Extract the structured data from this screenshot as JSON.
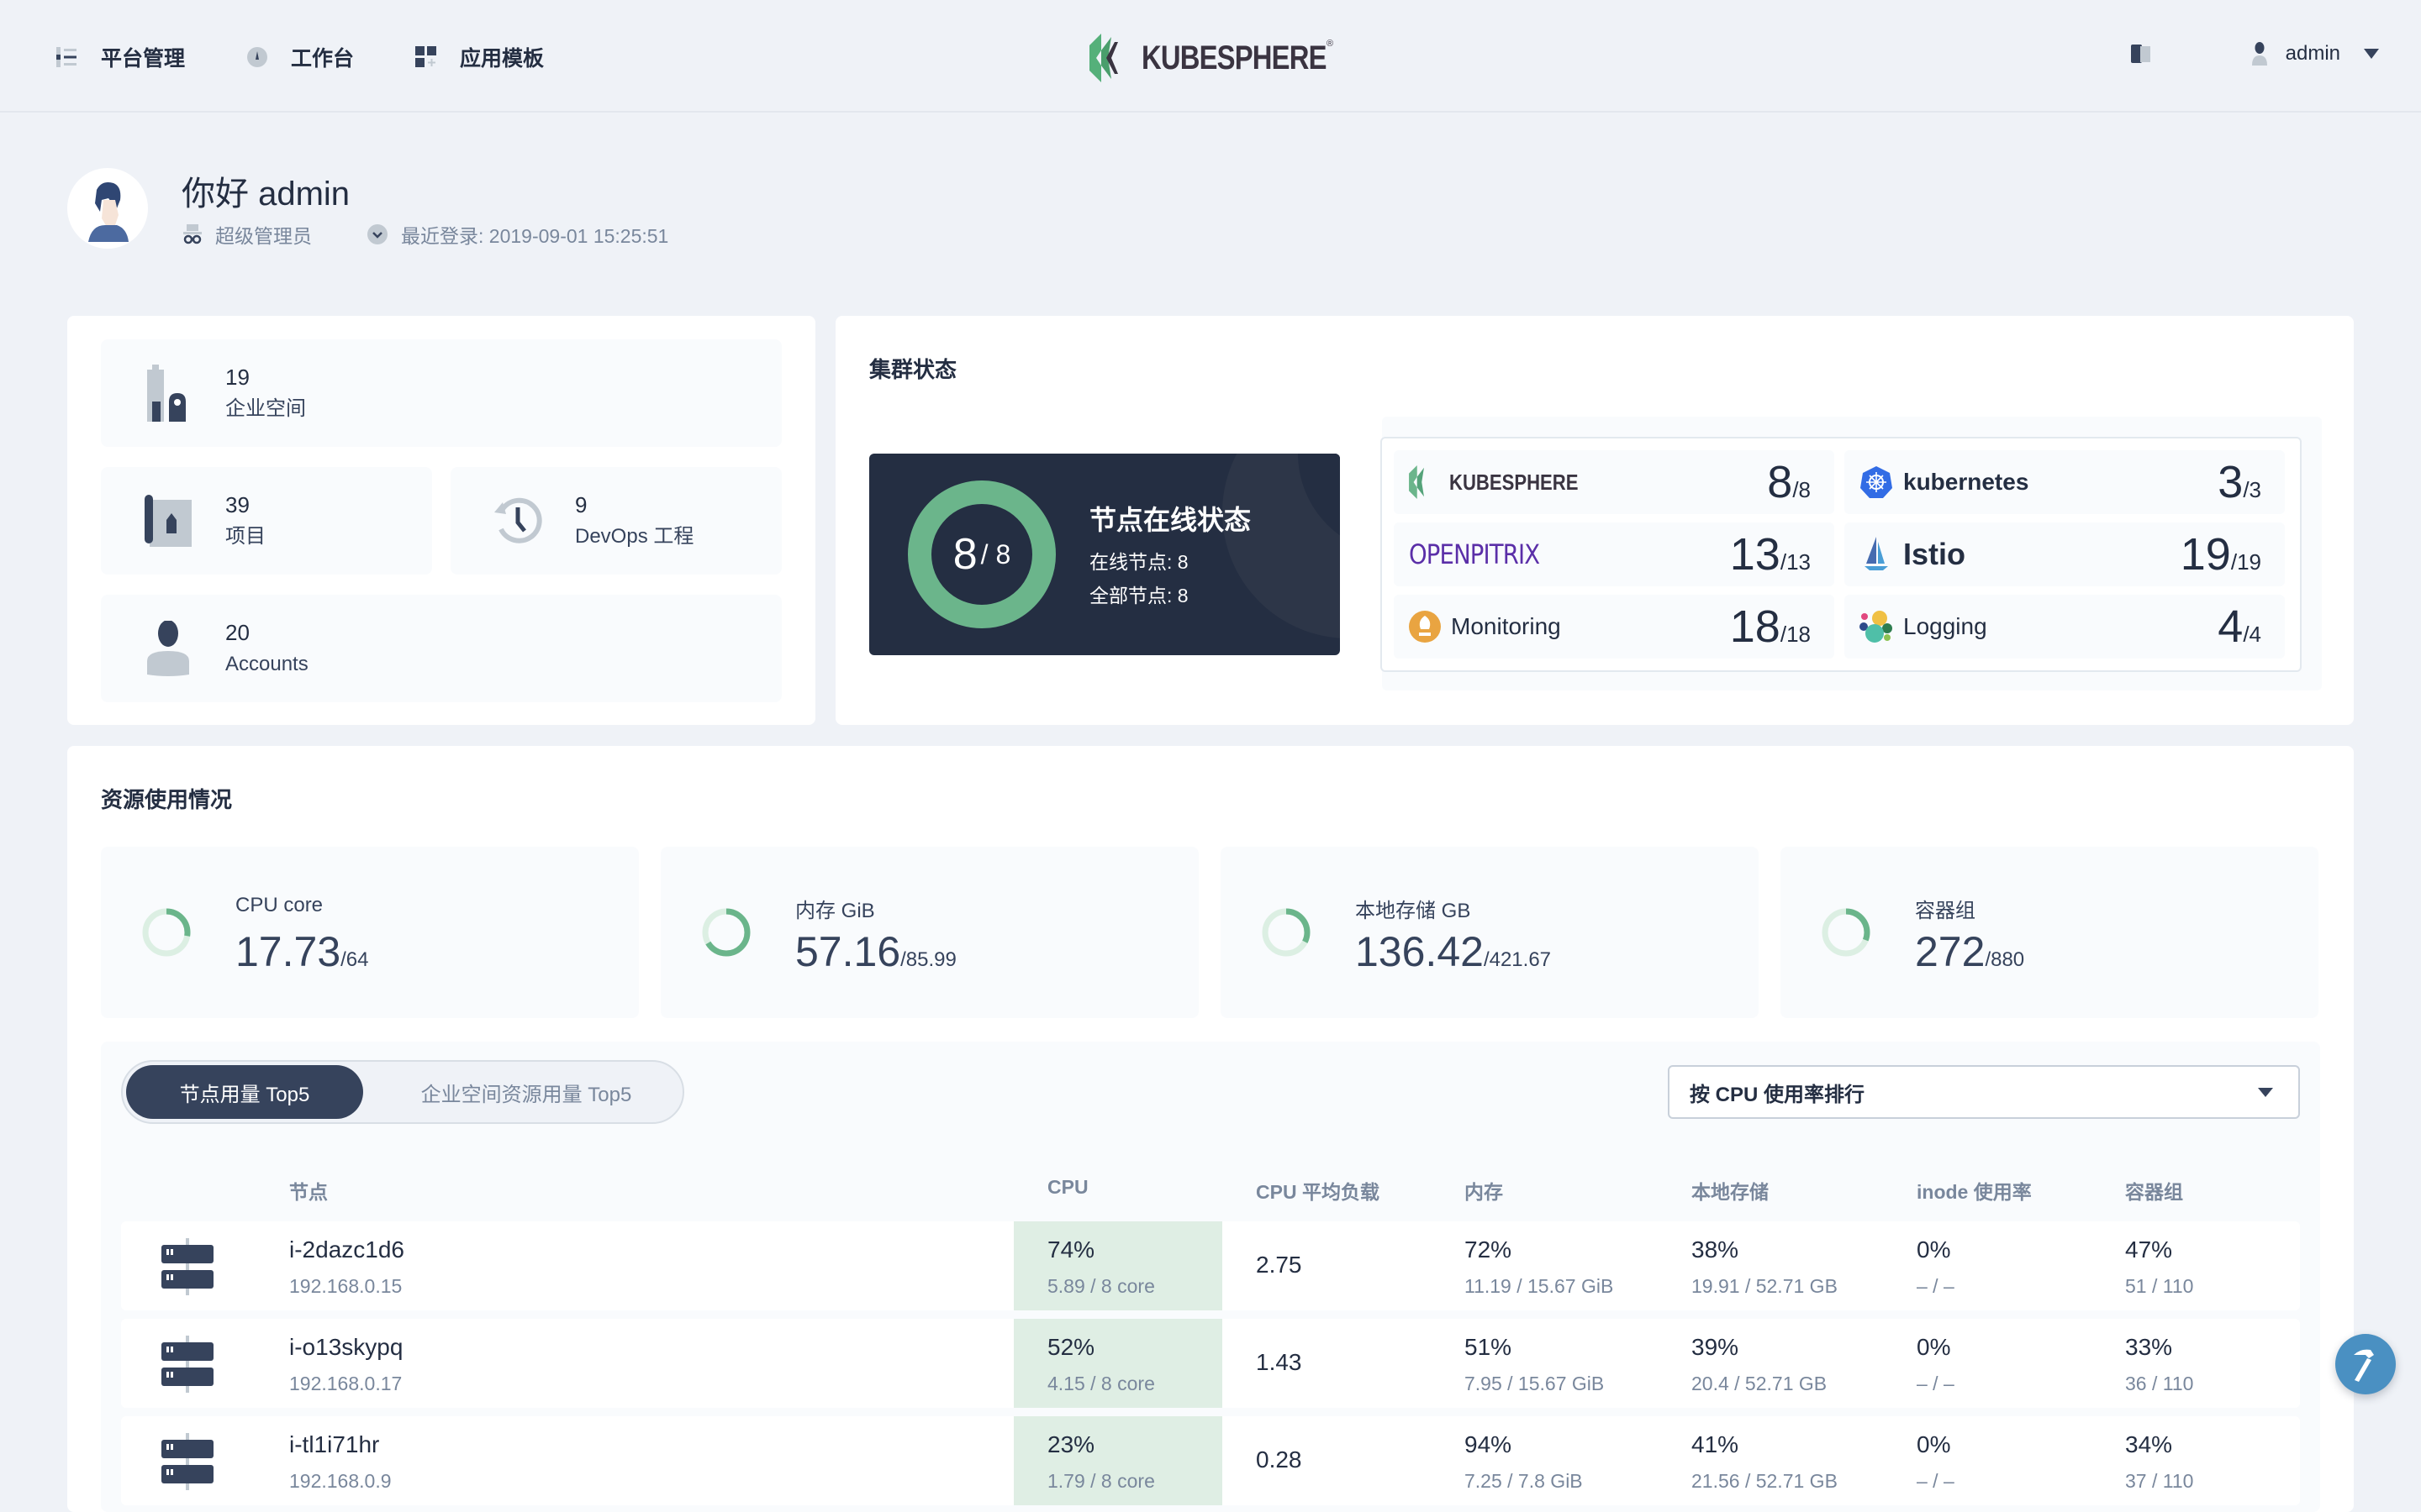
{
  "header": {
    "nav": [
      {
        "label": "平台管理",
        "icon": "list-icon"
      },
      {
        "label": "工作台",
        "icon": "dashboard-gauge-icon"
      },
      {
        "label": "应用模板",
        "icon": "app-template-icon"
      }
    ],
    "logo_text": "KUBESPHERE",
    "logo_mark": "®",
    "user_name": "admin"
  },
  "greeting": {
    "title": "你好 admin",
    "role": "超级管理员",
    "last_login": "最近登录: 2019-09-01 15:25:51"
  },
  "stats": [
    {
      "value": "19",
      "label": "企业空间",
      "icon": "workspace-building-icon"
    },
    {
      "value": "39",
      "label": "项目",
      "icon": "project-icon"
    },
    {
      "value": "9",
      "label": "DevOps 工程",
      "icon": "devops-history-icon"
    },
    {
      "value": "20",
      "label": "Accounts",
      "icon": "account-user-icon"
    }
  ],
  "cluster": {
    "title": "集群状态",
    "nodes": {
      "online": 8,
      "total": 8,
      "online_display": "8",
      "total_display": "/ 8",
      "title": "节点在线状态",
      "online_line": "在线节点: 8",
      "total_line": "全部节点: 8"
    },
    "components": [
      {
        "name": "KUBESPHERE",
        "icon": "kubesphere-logo-icon",
        "value": "8",
        "total": "/8"
      },
      {
        "name": "kubernetes",
        "icon": "kubernetes-helm-icon",
        "value": "3",
        "total": "/3"
      },
      {
        "name": "OPENPITRIX",
        "icon": "openpitrix-logo-icon",
        "value": "13",
        "total": "/13"
      },
      {
        "name": "Istio",
        "icon": "istio-sail-icon",
        "value": "19",
        "total": "/19"
      },
      {
        "name": "Monitoring",
        "icon": "prometheus-torch-icon",
        "value": "18",
        "total": "/18"
      },
      {
        "name": "Logging",
        "icon": "logging-elastic-icon",
        "value": "4",
        "total": "/4"
      }
    ]
  },
  "resources": {
    "title": "资源使用情况",
    "items": [
      {
        "label": "CPU core",
        "used": "17.73",
        "total": "/64",
        "ratio": 0.277
      },
      {
        "label": "内存 GiB",
        "used": "57.16",
        "total": "/85.99",
        "ratio": 0.665
      },
      {
        "label": "本地存储 GB",
        "used": "136.42",
        "total": "/421.67",
        "ratio": 0.324
      },
      {
        "label": "容器组",
        "used": "272",
        "total": "/880",
        "ratio": 0.309
      }
    ]
  },
  "ranking": {
    "tabs": [
      {
        "label": "节点用量 Top5",
        "active": true
      },
      {
        "label": "企业空间资源用量 Top5",
        "active": false
      }
    ],
    "sort_label": "按 CPU 使用率排行",
    "columns": [
      "节点",
      "CPU",
      "CPU 平均负载",
      "内存",
      "本地存储",
      "inode 使用率",
      "容器组"
    ],
    "rows": [
      {
        "name": "i-2dazc1d6",
        "ip": "192.168.0.15",
        "cpu": "74%",
        "cpu_detail": "5.89 / 8 core",
        "load": "2.75",
        "mem": "72%",
        "mem_detail": "11.19 / 15.67 GiB",
        "disk": "38%",
        "disk_detail": "19.91 / 52.71 GB",
        "inode": "0%",
        "inode_detail": "– / –",
        "pods": "47%",
        "pods_detail": "51 / 110"
      },
      {
        "name": "i-o13skypq",
        "ip": "192.168.0.17",
        "cpu": "52%",
        "cpu_detail": "4.15 / 8 core",
        "load": "1.43",
        "mem": "51%",
        "mem_detail": "7.95 / 15.67 GiB",
        "disk": "39%",
        "disk_detail": "20.4 / 52.71 GB",
        "inode": "0%",
        "inode_detail": "– / –",
        "pods": "33%",
        "pods_detail": "36 / 110"
      },
      {
        "name": "i-tl1i71hr",
        "ip": "192.168.0.9",
        "cpu": "23%",
        "cpu_detail": "1.79 / 8 core",
        "load": "0.28",
        "mem": "94%",
        "mem_detail": "7.25 / 7.8 GiB",
        "disk": "41%",
        "disk_detail": "21.56 / 52.71 GB",
        "inode": "0%",
        "inode_detail": "– / –",
        "pods": "34%",
        "pods_detail": "37 / 110"
      }
    ]
  },
  "colors": {
    "accent_green": "#6bb58b",
    "dark_navy": "#242e42",
    "slate": "#36435c",
    "muted": "#79879c",
    "fab_blue": "#4a90c2"
  }
}
